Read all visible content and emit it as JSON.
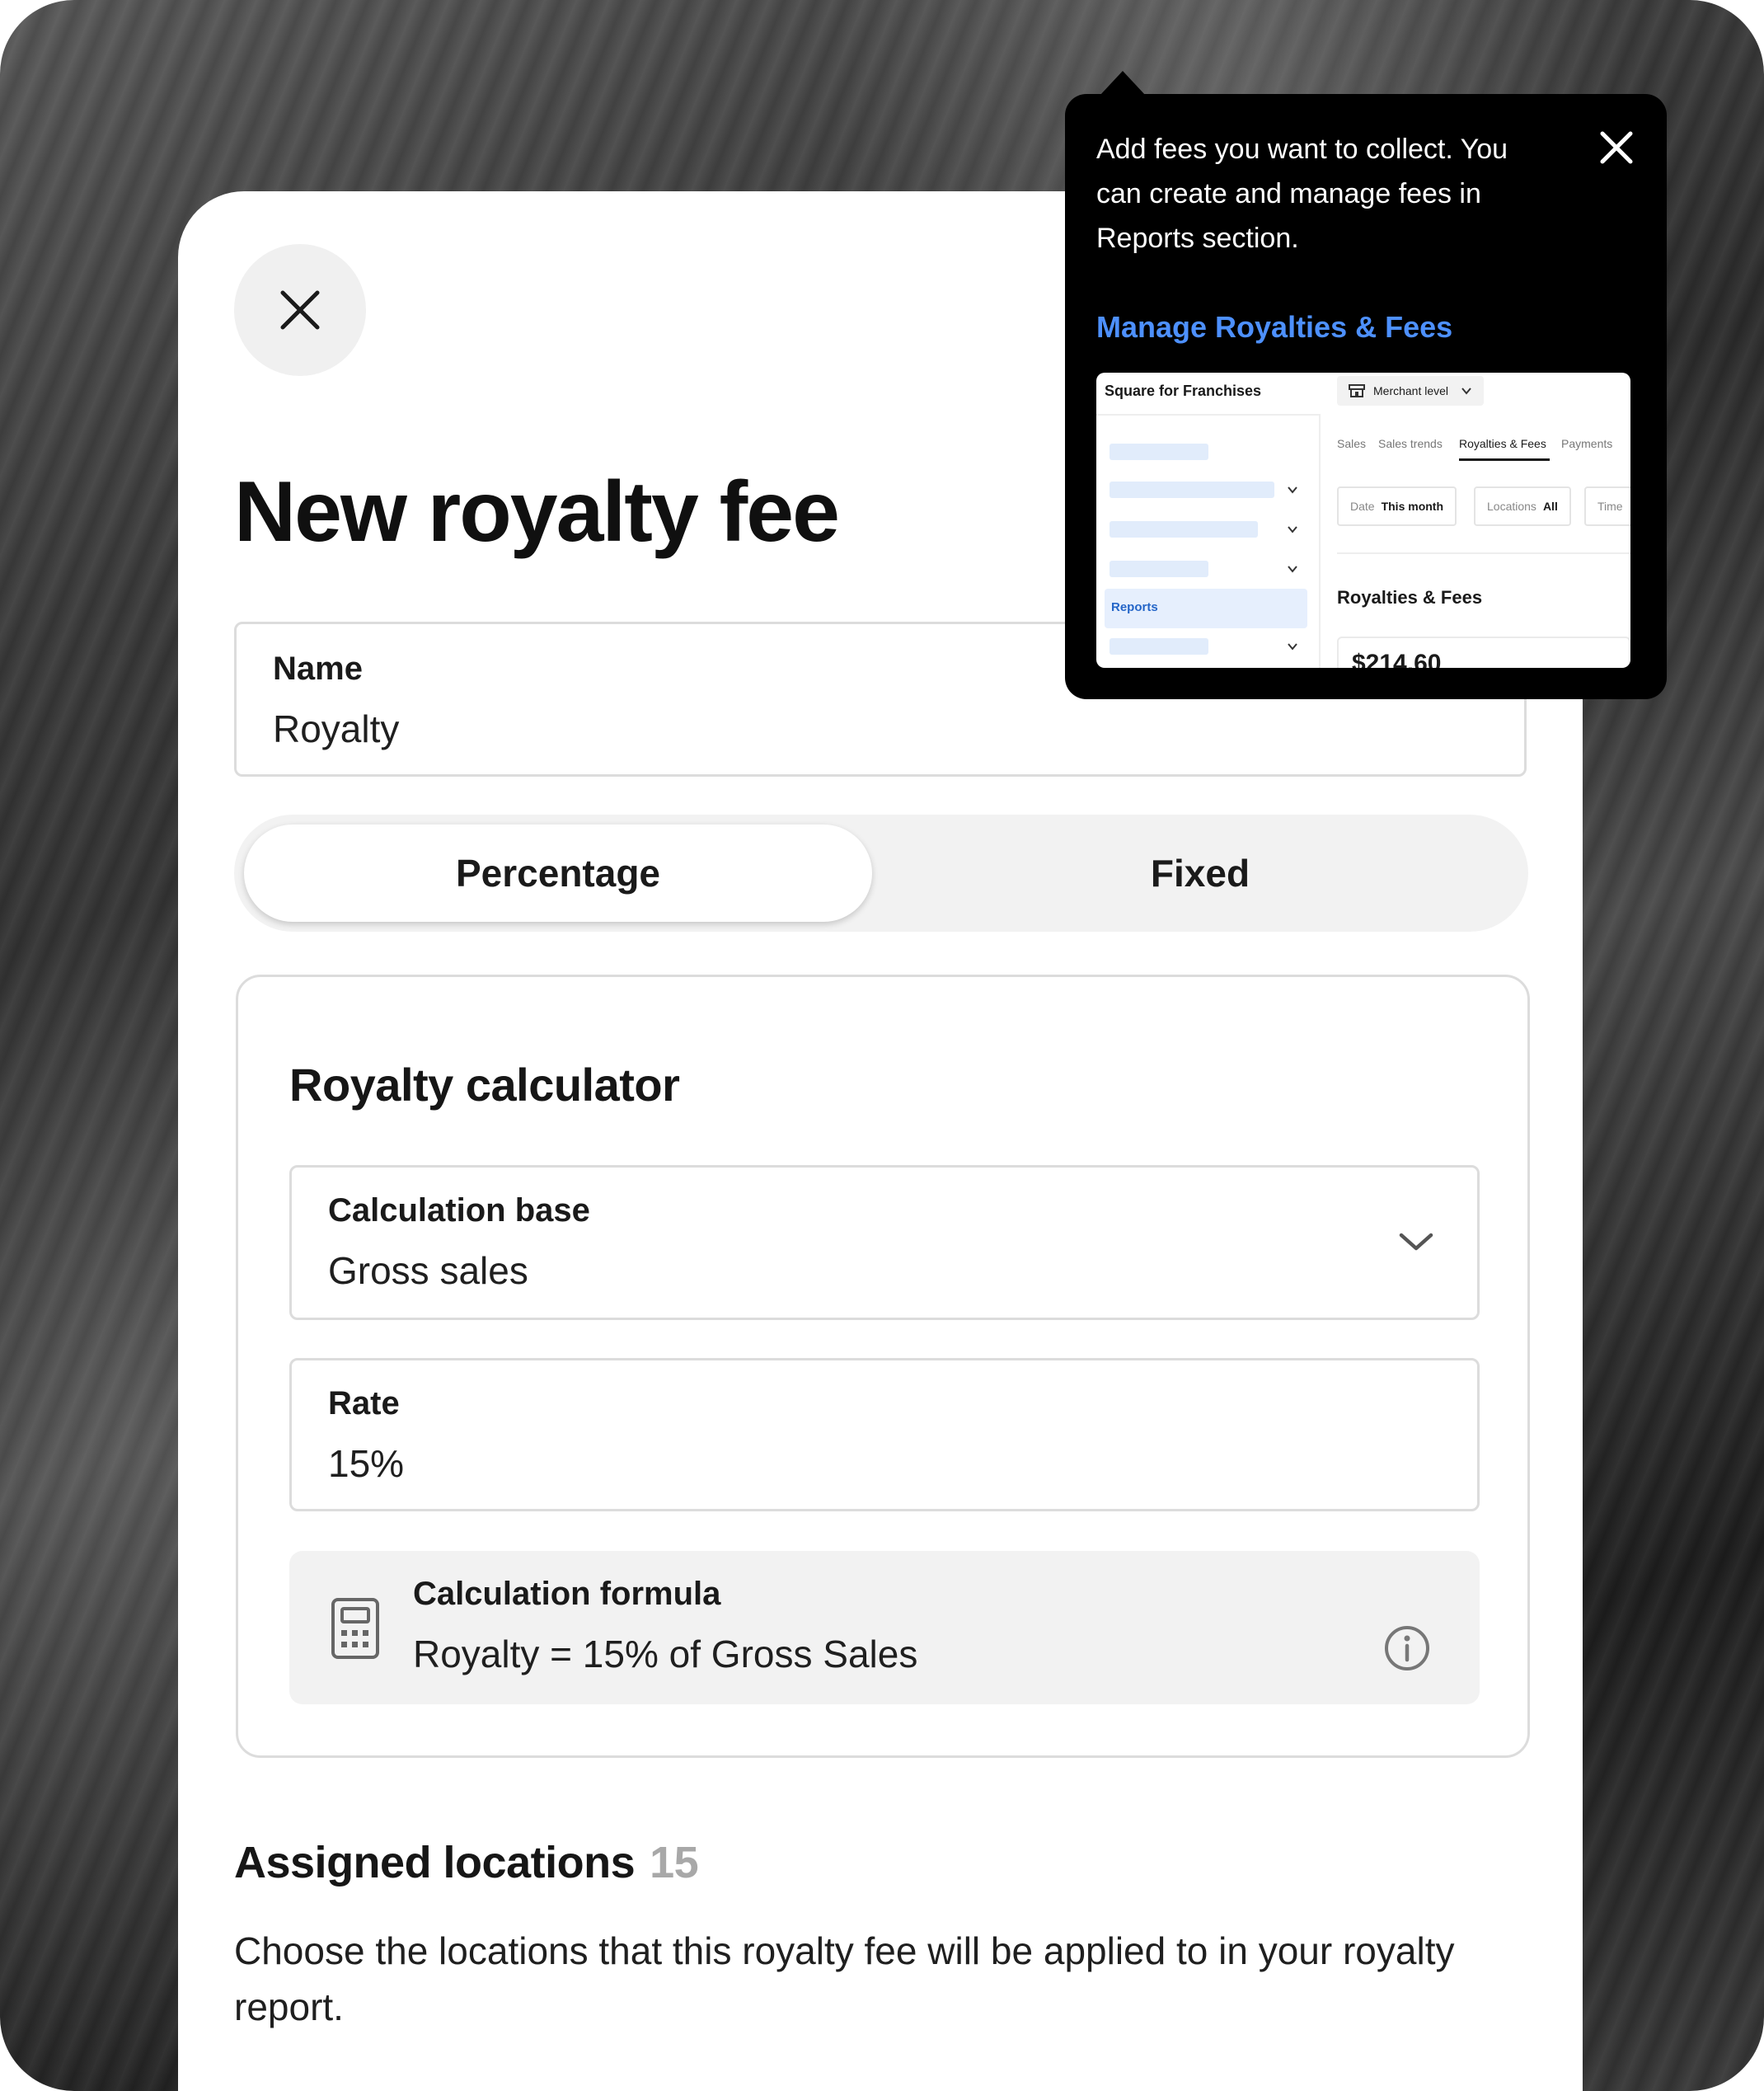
{
  "sheet": {
    "close_label": "Close",
    "title": "New royalty fee",
    "name_field": {
      "label": "Name",
      "value": "Royalty"
    },
    "fee_type": {
      "options": [
        "Percentage",
        "Fixed"
      ],
      "selected": "Percentage"
    },
    "calculator": {
      "title": "Royalty calculator",
      "calculation_base": {
        "label": "Calculation base",
        "value": "Gross sales"
      },
      "rate": {
        "label": "Rate",
        "value": "15%"
      },
      "formula": {
        "label": "Calculation formula",
        "value": "Royalty = 15% of Gross Sales"
      }
    },
    "assigned_locations": {
      "title": "Assigned locations",
      "count": "15",
      "description": "Choose the locations that this royalty fee will be applied to in your royalty report."
    }
  },
  "tooltip": {
    "text": "Add fees you want to collect. You can create and manage fees in Reports section.",
    "link": "Manage Royalties & Fees",
    "preview": {
      "brand": "Square for Franchises",
      "merchant_selector": "Merchant level",
      "sidebar_active": "Reports",
      "tabs": [
        "Sales",
        "Sales trends",
        "Royalties & Fees",
        "Payments"
      ],
      "active_tab": "Royalties & Fees",
      "filters": [
        {
          "label": "Date",
          "value": "This month"
        },
        {
          "label": "Locations",
          "value": "All"
        },
        {
          "label": "Time",
          "value": ""
        }
      ],
      "section_title": "Royalties & Fees",
      "amount": "$214.60"
    }
  },
  "colors": {
    "accent_link": "#4d90fe",
    "tooltip_bg": "#000000",
    "segment_bg": "#f2f2f2"
  },
  "icons": [
    "close-icon",
    "chevron-down-icon",
    "calculator-icon",
    "info-icon",
    "store-icon"
  ]
}
